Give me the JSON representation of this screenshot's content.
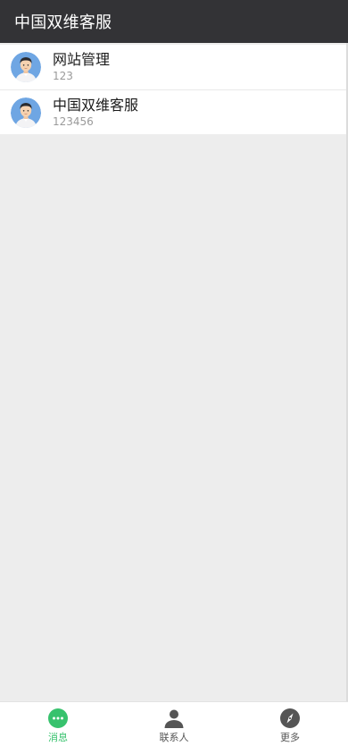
{
  "header": {
    "title": "中国双维客服"
  },
  "chats": [
    {
      "name": "网站管理",
      "preview": "123"
    },
    {
      "name": "中国双维客服",
      "preview": "123456"
    }
  ],
  "tabbar": {
    "tabs": [
      {
        "label": "消息",
        "icon": "chat-bubble-icon",
        "active": true
      },
      {
        "label": "联系人",
        "icon": "person-icon",
        "active": false
      },
      {
        "label": "更多",
        "icon": "compass-icon",
        "active": false
      }
    ]
  },
  "colors": {
    "header_bg": "#333336",
    "accent": "#37c26d",
    "background": "#ededed"
  }
}
